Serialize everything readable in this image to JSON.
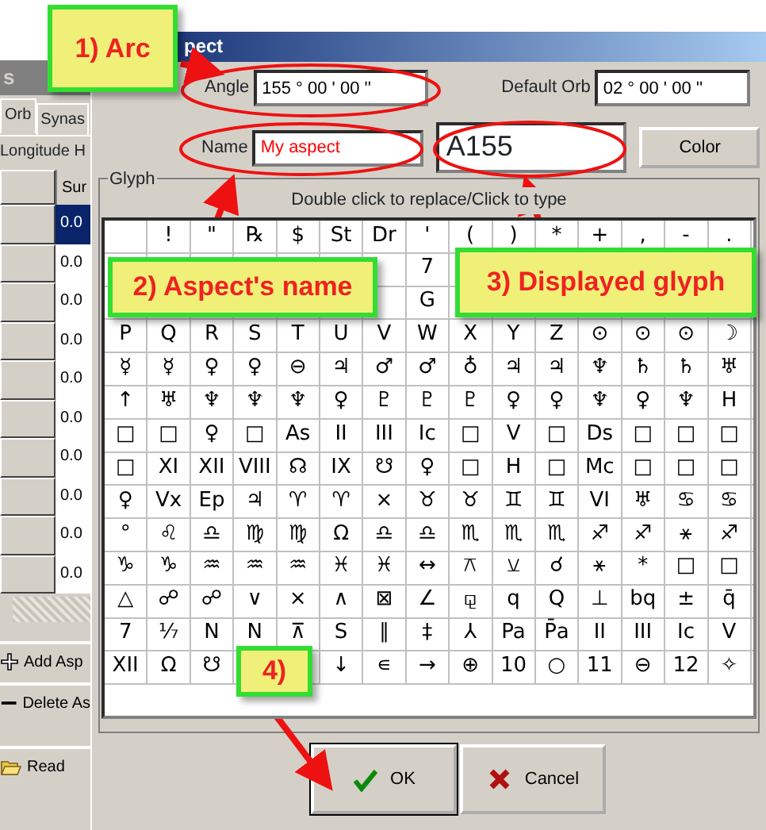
{
  "background_window": {
    "title": "s",
    "tabs": [
      {
        "label": "Orb",
        "selected": true
      },
      {
        "label": "Synas",
        "selected": false
      }
    ],
    "header": "Longitude H",
    "column": "Sur",
    "rows": [
      {
        "value": "0.0",
        "selected": true
      },
      {
        "value": "0.0",
        "selected": false
      },
      {
        "value": "0.0",
        "selected": false
      },
      {
        "value": "0.0",
        "selected": false
      },
      {
        "value": "0.0",
        "selected": false
      },
      {
        "value": "0.0",
        "selected": false
      },
      {
        "value": "0.0",
        "selected": false
      },
      {
        "value": "0.0",
        "selected": false
      },
      {
        "value": "0.0",
        "selected": false
      },
      {
        "value": "0.0",
        "selected": false
      }
    ],
    "buttons": [
      {
        "label": "Add Asp",
        "kind": "add"
      },
      {
        "label": "Delete As",
        "kind": "delete"
      },
      {
        "label": "Read",
        "kind": "read"
      }
    ]
  },
  "dialog": {
    "title": "pect",
    "angle": {
      "label": "Angle",
      "value": "155 ° 00 ' 00 ''"
    },
    "default_orb": {
      "label": "Default Orb",
      "value": "02 ° 00 ' 00 ''"
    },
    "name": {
      "label": "Name",
      "value": "My aspect"
    },
    "glyph_display": "A155",
    "color_button": "Color",
    "glyph": {
      "label": "Glyph",
      "hint": "Double click to replace/Click to type",
      "rows": [
        [
          null,
          "!",
          "\"",
          "℞",
          "$",
          "St",
          "Dr",
          "'",
          "(",
          ")",
          "*",
          "+",
          ",",
          "-",
          "."
        ],
        [
          null,
          null,
          null,
          null,
          null,
          null,
          null,
          "7",
          null,
          null,
          null,
          null,
          null,
          null,
          null
        ],
        [
          null,
          null,
          null,
          null,
          null,
          null,
          null,
          "G",
          null,
          null,
          null,
          null,
          null,
          null,
          null
        ],
        [
          "P",
          "Q",
          "R",
          "S",
          "T",
          "U",
          "V",
          "W",
          "X",
          "Y",
          "Z",
          "⊙",
          "⊙",
          "⊙",
          "☽"
        ],
        [
          "☿",
          "☿",
          "♀",
          "♀",
          "⊖",
          "♃",
          "♂",
          "♂",
          "♁",
          "♃",
          "♃",
          "♆",
          "♄",
          "♄",
          "♅"
        ],
        [
          "↑",
          "♅",
          "♆",
          "♆",
          "♆",
          "♀",
          "♇",
          "♇",
          "♇",
          "♀",
          "♀",
          "♆",
          "♀",
          "♆",
          "H"
        ],
        [
          "□",
          "□",
          "♀",
          "□",
          "As",
          "II",
          "III",
          "Ic",
          "□",
          "V",
          "□",
          "Ds",
          "□",
          "□",
          "□"
        ],
        [
          "□",
          "XI",
          "XII",
          "VIII",
          "☊",
          "IX",
          "☋",
          "♀",
          "□",
          "H",
          "□",
          "Mc",
          "□",
          "□",
          "□"
        ],
        [
          "♀",
          "Vx",
          "Ep",
          "♃",
          "♈",
          "♈",
          "×",
          "♉",
          "♉",
          "♊",
          "♊",
          "VI",
          "♅",
          "♋",
          "♋"
        ],
        [
          "°",
          "♌",
          "♎",
          "♍",
          "♍",
          "Ω",
          "♎",
          "♎",
          "♏",
          "♏",
          "♏",
          "♐",
          "♐",
          "⚹",
          "♐"
        ],
        [
          "♑",
          "♑",
          "♒",
          "♒",
          "♒",
          "♓",
          "♓",
          "↔",
          "⚻",
          "⚺",
          "☌",
          "⚹",
          "*",
          "□",
          "□"
        ],
        [
          "△",
          "☍",
          "☍",
          "∨",
          "×",
          "∧",
          "⊠",
          "∠",
          "⚼",
          "q",
          "Q",
          "⊥",
          "bq",
          "±",
          "q̄"
        ],
        [
          "7",
          "⅐",
          "N",
          "N",
          "⊼",
          "S",
          "∥",
          "‡",
          "⅄",
          "Pa",
          "P̄a",
          "II",
          "III",
          "Ic",
          "V"
        ],
        [
          "XII",
          "Ω",
          "☋",
          null,
          null,
          "↓",
          "∊",
          "→",
          "⊕",
          "10",
          "○",
          "11",
          "⊖",
          "12",
          "✧"
        ]
      ]
    },
    "buttons": [
      {
        "label": "OK",
        "kind": "ok"
      },
      {
        "label": "Cancel",
        "kind": "cancel"
      }
    ]
  },
  "callouts": [
    {
      "text": "1) Arc"
    },
    {
      "text": "2) Aspect's name"
    },
    {
      "text": "3) Displayed glyph"
    },
    {
      "text": "4)"
    }
  ]
}
